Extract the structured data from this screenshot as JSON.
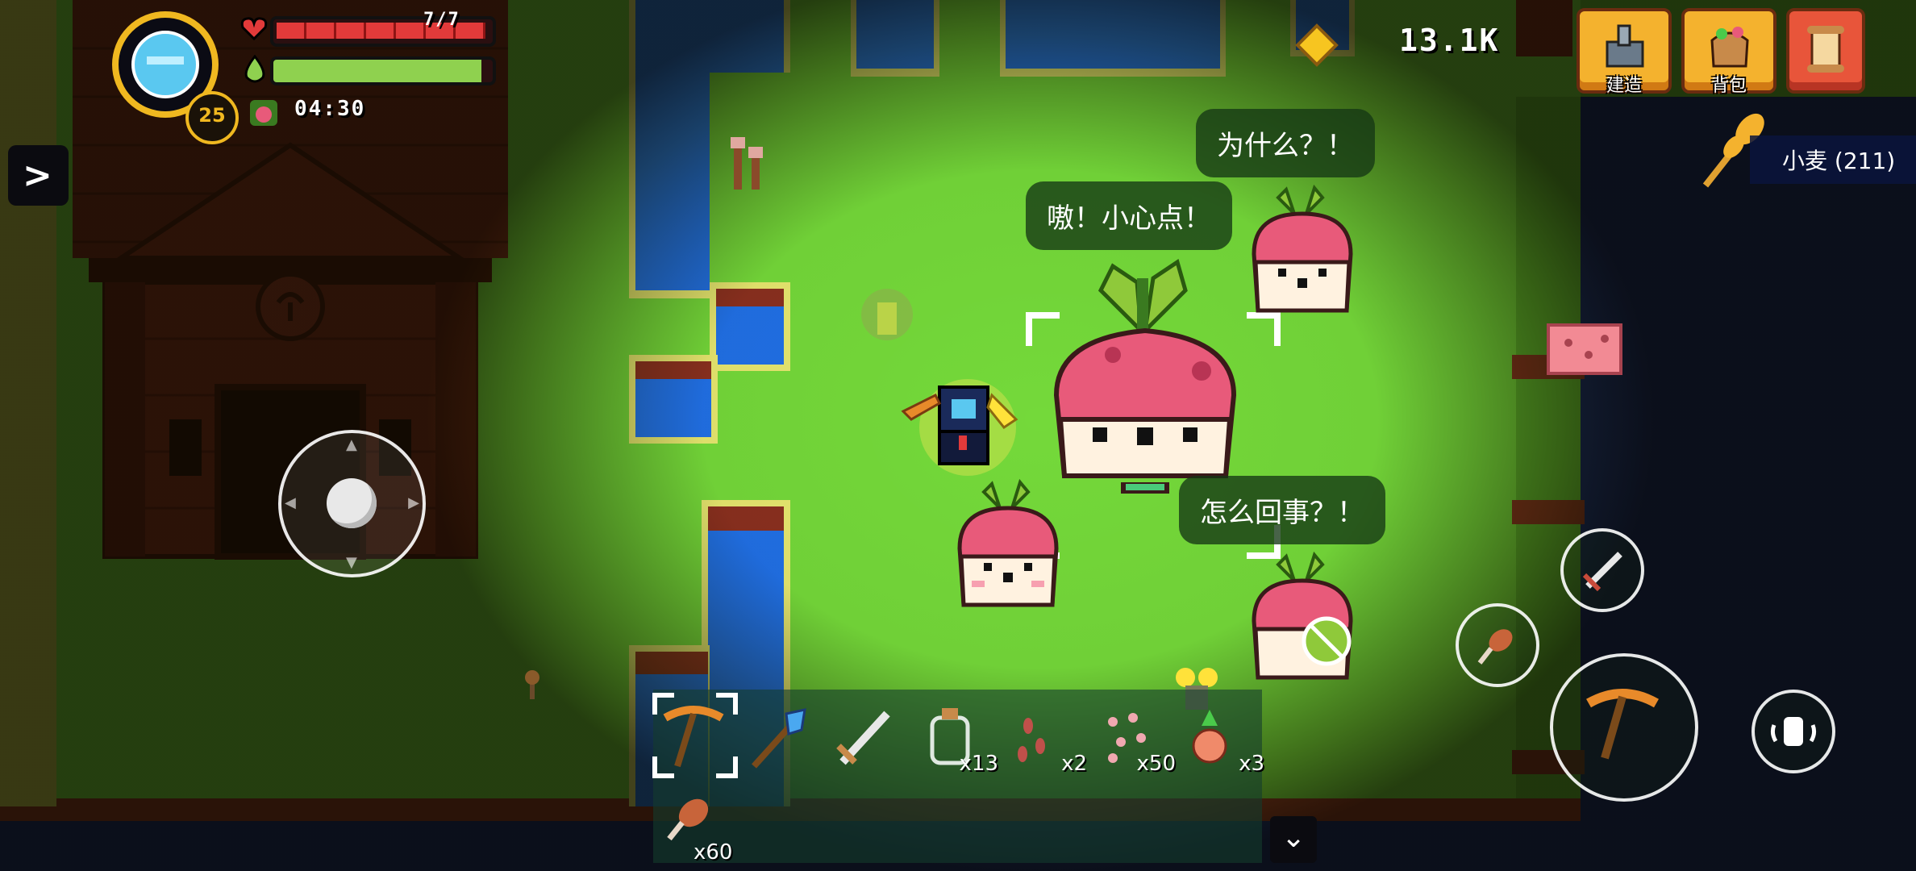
{
  "hud": {
    "level": "25",
    "hp_text": "7/7",
    "hp_current": 7,
    "hp_max": 7,
    "stamina_fraction": 0.95,
    "time": "04:30",
    "gold_amount": "13.1K"
  },
  "menu": {
    "build_label": "建造",
    "backpack_label": "背包"
  },
  "pickup": {
    "item_label": "小麦 (211)"
  },
  "speech": {
    "bubble1": "为什么？！",
    "bubble2": "嗷！小心点！",
    "bubble3": "怎么回事？！"
  },
  "hotbar": {
    "slot_counts": [
      "x13",
      "x2",
      "x50",
      "x3"
    ],
    "extra_count": "x60"
  },
  "icons": [
    "heart-icon",
    "stamina-drop-icon",
    "turnip-icon",
    "gold-gem-icon",
    "build-icon",
    "backpack-icon",
    "scroll-map-icon",
    "wheat-icon",
    "pickaxe-icon",
    "shovel-icon",
    "sword-icon",
    "bottle-icon",
    "seeds-icon",
    "cotton-icon",
    "beet-seed-icon",
    "drumstick-icon",
    "chevron-down-icon",
    "chevron-right-icon",
    "dodge-icon"
  ],
  "colors": {
    "grass": "#74d93a",
    "water": "#1f6fe8",
    "hp": "#e23a3a",
    "stamina": "#8fd14f",
    "button_gold": "#f4b22e"
  }
}
